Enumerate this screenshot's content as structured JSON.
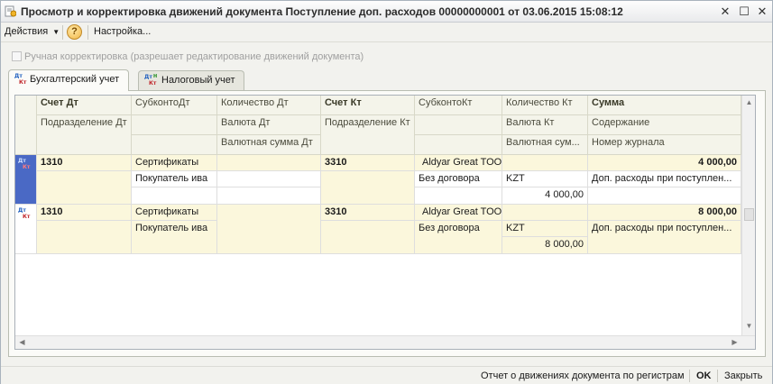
{
  "window": {
    "title": "Просмотр и корректировка движений документа Поступление доп. расходов 00000000001 от 03.06.2015 15:08:12",
    "icons": [
      "document-movements-icon",
      "close-icon",
      "maximize-icon",
      "close-window-icon"
    ]
  },
  "toolbar": {
    "actions_label": "Действия",
    "help_label": "?",
    "settings_label": "Настройка..."
  },
  "manual_correction": {
    "label": "Ручная корректировка (разрешает редактирование движений документа)",
    "checked": false
  },
  "tabs": [
    {
      "label": "Бухгалтерский учет",
      "active": true
    },
    {
      "label": "Налоговый учет",
      "active": false
    }
  ],
  "grid": {
    "headers": {
      "row1": [
        "Счет Дт",
        "СубконтоДт",
        "Количество Дт",
        "Счет Кт",
        "СубконтоКт",
        "Количество Кт",
        "Сумма"
      ],
      "row2": [
        "Подразделение Дт",
        "",
        "Валюта Дт",
        "Подразделение Кт",
        "",
        "Валюта Кт",
        "Содержание"
      ],
      "row3": [
        "",
        "",
        "Валютная сумма Дт",
        "",
        "",
        "Валютная сум...",
        "Номер журнала"
      ]
    },
    "rows": [
      {
        "schet_dt": "1310",
        "subkonto_dt_1": "Сертификаты",
        "subkonto_dt_2": "Покупатель ива",
        "schet_kt": "3310",
        "subkonto_kt_1": "Aldyar Great TOO",
        "subkonto_kt_2": "Без договора",
        "valuta_kt": "KZT",
        "val_summa_kt": "4 000,00",
        "summa": "4 000,00",
        "soderzhanie": "Доп. расходы при поступлен..."
      },
      {
        "schet_dt": "1310",
        "subkonto_dt_1": "Сертификаты",
        "subkonto_dt_2": "Покупатель ива",
        "schet_kt": "3310",
        "subkonto_kt_1": "Aldyar Great TOO",
        "subkonto_kt_2": "Без договора",
        "valuta_kt": "KZT",
        "val_summa_kt": "8 000,00",
        "summa": "8 000,00",
        "soderzhanie": "Доп. расходы при поступлен..."
      }
    ]
  },
  "footer": {
    "report_label": "Отчет о движениях документа по регистрам",
    "ok_label": "OK",
    "close_label": "Закрыть"
  },
  "colors": {
    "header_bg": "#f4f4ea",
    "row_highlight": "#fbf7dc",
    "selection": "#4a69c5",
    "dt_mark": "#1f5fbf",
    "kt_mark": "#c0262b"
  }
}
